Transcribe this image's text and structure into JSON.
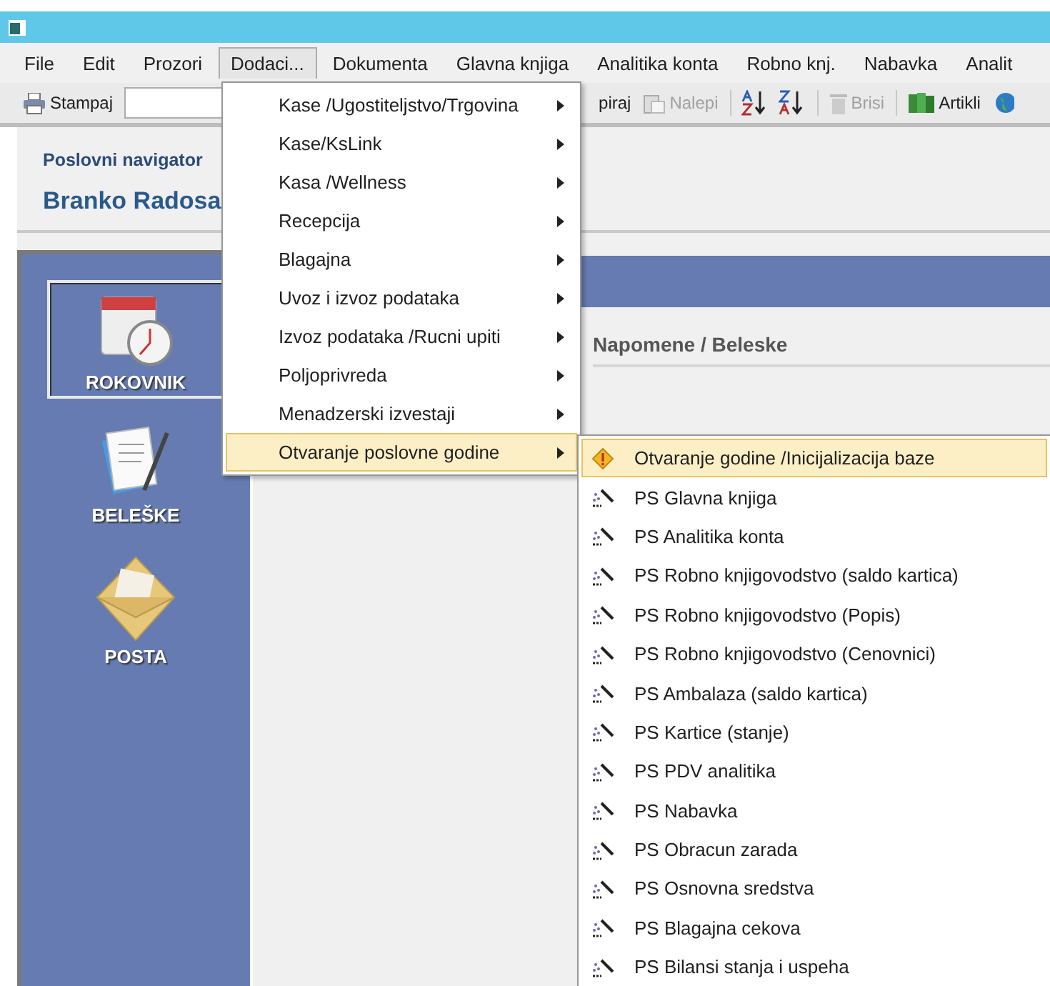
{
  "menubar": [
    {
      "label": "File",
      "selected": false
    },
    {
      "label": "Edit",
      "selected": false
    },
    {
      "label": "Prozori",
      "selected": false
    },
    {
      "label": "Dodaci...",
      "selected": true
    },
    {
      "label": "Dokumenta",
      "selected": false
    },
    {
      "label": "Glavna knjiga",
      "selected": false
    },
    {
      "label": "Analitika konta",
      "selected": false
    },
    {
      "label": "Robno knj.",
      "selected": false
    },
    {
      "label": "Nabavka",
      "selected": false
    },
    {
      "label": "Analit",
      "selected": false
    }
  ],
  "toolbar": {
    "left": [
      {
        "kind": "print",
        "label": "Stampaj",
        "disabled": false
      },
      {
        "kind": "field"
      }
    ],
    "right": [
      {
        "kind": "text",
        "label": "piraj",
        "disabled": false
      },
      {
        "kind": "paste",
        "label": "Nalepi",
        "disabled": true
      },
      {
        "kind": "separator"
      },
      {
        "kind": "sort-az"
      },
      {
        "kind": "sort-za"
      },
      {
        "kind": "separator"
      },
      {
        "kind": "trash",
        "label": "Brisi",
        "disabled": true
      },
      {
        "kind": "separator"
      },
      {
        "kind": "books",
        "label": "Artikli",
        "disabled": false
      },
      {
        "kind": "globe"
      }
    ]
  },
  "header": {
    "subtitle": "Poslovni navigator",
    "title": "Branko Radosa"
  },
  "sidebar": {
    "items": [
      {
        "label": "ROKOVNIK",
        "kind": "calendar",
        "selected": true
      },
      {
        "label": "BELEŠKE",
        "kind": "notes",
        "selected": false
      },
      {
        "label": "POSTA",
        "kind": "mail",
        "selected": false
      }
    ]
  },
  "content": {
    "heading": "Napomene / Beleske"
  },
  "dropdown": {
    "items": [
      {
        "label": "Kase /Ugostiteljstvo/Trgovina",
        "selected": false
      },
      {
        "label": "Kase/KsLink",
        "selected": false
      },
      {
        "label": "Kasa /Wellness",
        "selected": false
      },
      {
        "label": "Recepcija",
        "selected": false
      },
      {
        "label": "Blagajna",
        "selected": false
      },
      {
        "label": "Uvoz i izvoz podataka",
        "selected": false
      },
      {
        "label": "Izvoz podataka /Rucni upiti",
        "selected": false
      },
      {
        "label": "Poljoprivreda",
        "selected": false
      },
      {
        "label": "Menadzerski izvestaji",
        "selected": false
      },
      {
        "label": "Otvaranje poslovne godine",
        "selected": true
      }
    ]
  },
  "submenu": {
    "items": [
      {
        "label": "Otvaranje godine /Inicijalizacija baze",
        "kind": "warning",
        "selected": true
      },
      {
        "label": "PS Glavna knjiga",
        "kind": "wand",
        "selected": false
      },
      {
        "label": "PS Analitika konta",
        "kind": "wand",
        "selected": false
      },
      {
        "label": "PS Robno knjigovodstvo (saldo kartica)",
        "kind": "wand",
        "selected": false
      },
      {
        "label": "PS Robno knjigovodstvo (Popis)",
        "kind": "wand",
        "selected": false
      },
      {
        "label": "PS Robno knjigovodstvo (Cenovnici)",
        "kind": "wand",
        "selected": false
      },
      {
        "label": "PS Ambalaza (saldo kartica)",
        "kind": "wand",
        "selected": false
      },
      {
        "label": "PS Kartice (stanje)",
        "kind": "wand",
        "selected": false
      },
      {
        "label": "PS PDV analitika",
        "kind": "wand",
        "selected": false
      },
      {
        "label": "PS Nabavka",
        "kind": "wand",
        "selected": false
      },
      {
        "label": "PS Obracun zarada",
        "kind": "wand",
        "selected": false
      },
      {
        "label": "PS Osnovna sredstva",
        "kind": "wand",
        "selected": false
      },
      {
        "label": "PS Blagajna cekova",
        "kind": "wand",
        "selected": false
      },
      {
        "label": "PS Bilansi stanja i uspeha",
        "kind": "wand",
        "selected": false
      }
    ]
  }
}
